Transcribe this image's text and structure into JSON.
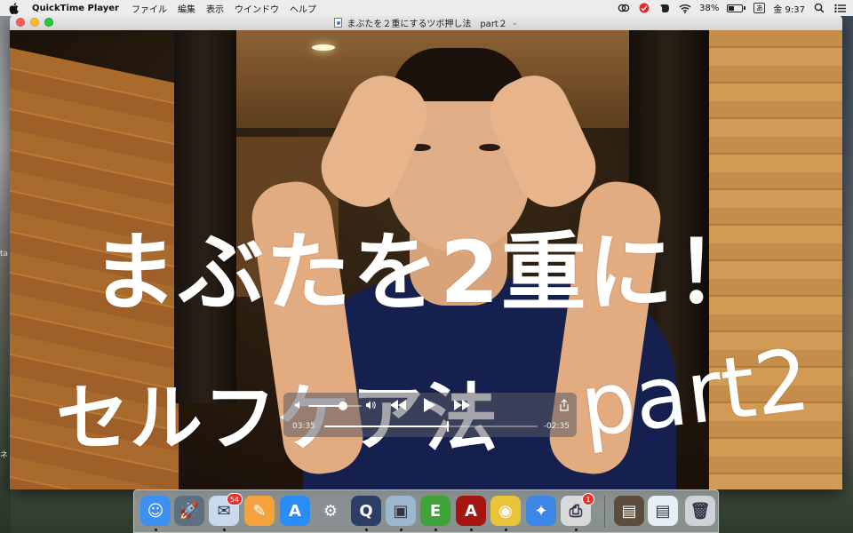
{
  "menubar": {
    "app_name": "QuickTime Player",
    "menus": [
      "ファイル",
      "編集",
      "表示",
      "ウインドウ",
      "ヘルプ"
    ],
    "battery_percent": "38%",
    "battery_level": 0.38,
    "input_source": "あ",
    "clock": "金 9:37"
  },
  "desktop": {
    "hint_1": "ta",
    "hint_2": "ネ"
  },
  "window": {
    "title": "まぶたを２重にするツボ押し法　part２"
  },
  "video": {
    "caption_line1": "まぶたを2重に！",
    "caption_line2": "セルフケア法",
    "caption_part": "part2"
  },
  "player": {
    "elapsed": "03:35",
    "remaining": "-02:35",
    "progress": 0.58,
    "volume": 0.65
  },
  "dock": {
    "items": [
      {
        "name": "finder",
        "color": "#3d8ff0",
        "glyph": "☺",
        "running": true
      },
      {
        "name": "launchpad",
        "color": "#5f6f82",
        "glyph": "🚀",
        "running": false
      },
      {
        "name": "mail",
        "color": "#c9d9ee",
        "glyph": "✉",
        "running": true,
        "badge": "54"
      },
      {
        "name": "pages",
        "color": "#f4a33c",
        "glyph": "✎",
        "running": false
      },
      {
        "name": "app-store",
        "color": "#2a8df5",
        "glyph": "A",
        "running": false
      },
      {
        "name": "system-preferences",
        "color": "#8b8f95",
        "glyph": "⚙",
        "running": false
      },
      {
        "name": "quicktime",
        "color": "#2b3e66",
        "glyph": "Q",
        "running": true
      },
      {
        "name": "preview",
        "color": "#9cb7cf",
        "glyph": "▣",
        "running": true
      },
      {
        "name": "evernote",
        "color": "#40a33a",
        "glyph": "E",
        "running": true
      },
      {
        "name": "acrobat",
        "color": "#a51612",
        "glyph": "A",
        "running": true
      },
      {
        "name": "chrome",
        "color": "#e9c43b",
        "glyph": "◉",
        "running": true
      },
      {
        "name": "safari",
        "color": "#3e86e6",
        "glyph": "✦",
        "running": false
      },
      {
        "name": "printer",
        "color": "#d9d9d9",
        "glyph": "⎙",
        "running": true,
        "badge": "1"
      },
      {
        "name": "minimized-window-1",
        "color": "#5b4c3c",
        "glyph": "▤",
        "running": false
      },
      {
        "name": "minimized-window-2",
        "color": "#e6eef6",
        "glyph": "▤",
        "running": false
      },
      {
        "name": "trash",
        "color": "#cfd3d8",
        "glyph": "🗑",
        "running": false
      }
    ]
  }
}
